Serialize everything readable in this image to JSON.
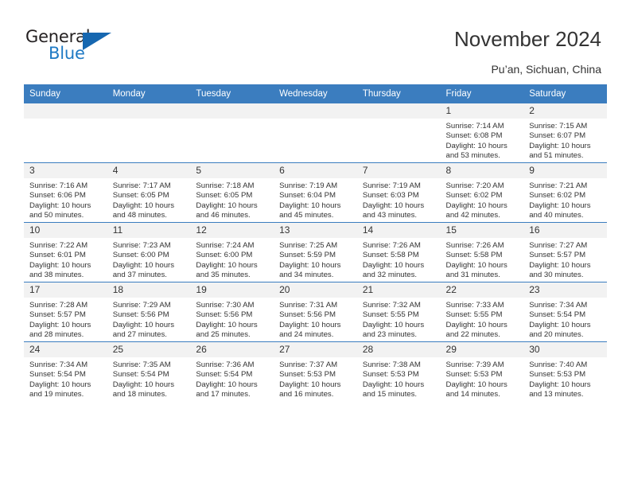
{
  "brand": {
    "name_top": "General",
    "name_bottom": "Blue"
  },
  "header": {
    "title": "November 2024",
    "subtitle": "Pu’an, Sichuan, China"
  },
  "calendar": {
    "weekday_headers": [
      "Sunday",
      "Monday",
      "Tuesday",
      "Wednesday",
      "Thursday",
      "Friday",
      "Saturday"
    ],
    "accent_color": "#3b7dbf",
    "daynum_strip_color": "#f2f2f2",
    "weeks": [
      [
        {
          "day": "",
          "empty": true
        },
        {
          "day": "",
          "empty": true
        },
        {
          "day": "",
          "empty": true
        },
        {
          "day": "",
          "empty": true
        },
        {
          "day": "",
          "empty": true
        },
        {
          "day": "1",
          "sunrise": "Sunrise: 7:14 AM",
          "sunset": "Sunset: 6:08 PM",
          "daylight1": "Daylight: 10 hours",
          "daylight2": "and 53 minutes."
        },
        {
          "day": "2",
          "sunrise": "Sunrise: 7:15 AM",
          "sunset": "Sunset: 6:07 PM",
          "daylight1": "Daylight: 10 hours",
          "daylight2": "and 51 minutes."
        }
      ],
      [
        {
          "day": "3",
          "sunrise": "Sunrise: 7:16 AM",
          "sunset": "Sunset: 6:06 PM",
          "daylight1": "Daylight: 10 hours",
          "daylight2": "and 50 minutes."
        },
        {
          "day": "4",
          "sunrise": "Sunrise: 7:17 AM",
          "sunset": "Sunset: 6:05 PM",
          "daylight1": "Daylight: 10 hours",
          "daylight2": "and 48 minutes."
        },
        {
          "day": "5",
          "sunrise": "Sunrise: 7:18 AM",
          "sunset": "Sunset: 6:05 PM",
          "daylight1": "Daylight: 10 hours",
          "daylight2": "and 46 minutes."
        },
        {
          "day": "6",
          "sunrise": "Sunrise: 7:19 AM",
          "sunset": "Sunset: 6:04 PM",
          "daylight1": "Daylight: 10 hours",
          "daylight2": "and 45 minutes."
        },
        {
          "day": "7",
          "sunrise": "Sunrise: 7:19 AM",
          "sunset": "Sunset: 6:03 PM",
          "daylight1": "Daylight: 10 hours",
          "daylight2": "and 43 minutes."
        },
        {
          "day": "8",
          "sunrise": "Sunrise: 7:20 AM",
          "sunset": "Sunset: 6:02 PM",
          "daylight1": "Daylight: 10 hours",
          "daylight2": "and 42 minutes."
        },
        {
          "day": "9",
          "sunrise": "Sunrise: 7:21 AM",
          "sunset": "Sunset: 6:02 PM",
          "daylight1": "Daylight: 10 hours",
          "daylight2": "and 40 minutes."
        }
      ],
      [
        {
          "day": "10",
          "sunrise": "Sunrise: 7:22 AM",
          "sunset": "Sunset: 6:01 PM",
          "daylight1": "Daylight: 10 hours",
          "daylight2": "and 38 minutes."
        },
        {
          "day": "11",
          "sunrise": "Sunrise: 7:23 AM",
          "sunset": "Sunset: 6:00 PM",
          "daylight1": "Daylight: 10 hours",
          "daylight2": "and 37 minutes."
        },
        {
          "day": "12",
          "sunrise": "Sunrise: 7:24 AM",
          "sunset": "Sunset: 6:00 PM",
          "daylight1": "Daylight: 10 hours",
          "daylight2": "and 35 minutes."
        },
        {
          "day": "13",
          "sunrise": "Sunrise: 7:25 AM",
          "sunset": "Sunset: 5:59 PM",
          "daylight1": "Daylight: 10 hours",
          "daylight2": "and 34 minutes."
        },
        {
          "day": "14",
          "sunrise": "Sunrise: 7:26 AM",
          "sunset": "Sunset: 5:58 PM",
          "daylight1": "Daylight: 10 hours",
          "daylight2": "and 32 minutes."
        },
        {
          "day": "15",
          "sunrise": "Sunrise: 7:26 AM",
          "sunset": "Sunset: 5:58 PM",
          "daylight1": "Daylight: 10 hours",
          "daylight2": "and 31 minutes."
        },
        {
          "day": "16",
          "sunrise": "Sunrise: 7:27 AM",
          "sunset": "Sunset: 5:57 PM",
          "daylight1": "Daylight: 10 hours",
          "daylight2": "and 30 minutes."
        }
      ],
      [
        {
          "day": "17",
          "sunrise": "Sunrise: 7:28 AM",
          "sunset": "Sunset: 5:57 PM",
          "daylight1": "Daylight: 10 hours",
          "daylight2": "and 28 minutes."
        },
        {
          "day": "18",
          "sunrise": "Sunrise: 7:29 AM",
          "sunset": "Sunset: 5:56 PM",
          "daylight1": "Daylight: 10 hours",
          "daylight2": "and 27 minutes."
        },
        {
          "day": "19",
          "sunrise": "Sunrise: 7:30 AM",
          "sunset": "Sunset: 5:56 PM",
          "daylight1": "Daylight: 10 hours",
          "daylight2": "and 25 minutes."
        },
        {
          "day": "20",
          "sunrise": "Sunrise: 7:31 AM",
          "sunset": "Sunset: 5:56 PM",
          "daylight1": "Daylight: 10 hours",
          "daylight2": "and 24 minutes."
        },
        {
          "day": "21",
          "sunrise": "Sunrise: 7:32 AM",
          "sunset": "Sunset: 5:55 PM",
          "daylight1": "Daylight: 10 hours",
          "daylight2": "and 23 minutes."
        },
        {
          "day": "22",
          "sunrise": "Sunrise: 7:33 AM",
          "sunset": "Sunset: 5:55 PM",
          "daylight1": "Daylight: 10 hours",
          "daylight2": "and 22 minutes."
        },
        {
          "day": "23",
          "sunrise": "Sunrise: 7:34 AM",
          "sunset": "Sunset: 5:54 PM",
          "daylight1": "Daylight: 10 hours",
          "daylight2": "and 20 minutes."
        }
      ],
      [
        {
          "day": "24",
          "sunrise": "Sunrise: 7:34 AM",
          "sunset": "Sunset: 5:54 PM",
          "daylight1": "Daylight: 10 hours",
          "daylight2": "and 19 minutes."
        },
        {
          "day": "25",
          "sunrise": "Sunrise: 7:35 AM",
          "sunset": "Sunset: 5:54 PM",
          "daylight1": "Daylight: 10 hours",
          "daylight2": "and 18 minutes."
        },
        {
          "day": "26",
          "sunrise": "Sunrise: 7:36 AM",
          "sunset": "Sunset: 5:54 PM",
          "daylight1": "Daylight: 10 hours",
          "daylight2": "and 17 minutes."
        },
        {
          "day": "27",
          "sunrise": "Sunrise: 7:37 AM",
          "sunset": "Sunset: 5:53 PM",
          "daylight1": "Daylight: 10 hours",
          "daylight2": "and 16 minutes."
        },
        {
          "day": "28",
          "sunrise": "Sunrise: 7:38 AM",
          "sunset": "Sunset: 5:53 PM",
          "daylight1": "Daylight: 10 hours",
          "daylight2": "and 15 minutes."
        },
        {
          "day": "29",
          "sunrise": "Sunrise: 7:39 AM",
          "sunset": "Sunset: 5:53 PM",
          "daylight1": "Daylight: 10 hours",
          "daylight2": "and 14 minutes."
        },
        {
          "day": "30",
          "sunrise": "Sunrise: 7:40 AM",
          "sunset": "Sunset: 5:53 PM",
          "daylight1": "Daylight: 10 hours",
          "daylight2": "and 13 minutes."
        }
      ]
    ]
  }
}
